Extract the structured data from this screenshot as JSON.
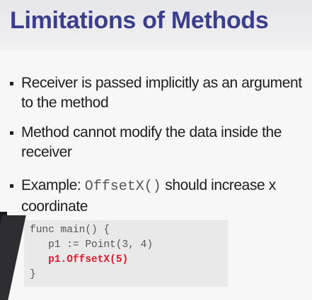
{
  "slide": {
    "title": "Limitations of Methods",
    "bullets": [
      {
        "text": "Receiver is passed implicitly as an argument to the method"
      },
      {
        "text": "Method cannot modify the data inside the receiver"
      },
      {
        "prefix": "Example: ",
        "code": "OffsetX()",
        "suffix": " should increase x coordinate"
      }
    ],
    "code_lines": [
      "func main() {",
      "   p1 := Point(3, 4)",
      "   p1.OffsetX(5)",
      "}"
    ]
  },
  "colors": {
    "title": "#3b3e8c",
    "code_highlight": "#e2192c",
    "code_background": "#e9e9e9"
  }
}
